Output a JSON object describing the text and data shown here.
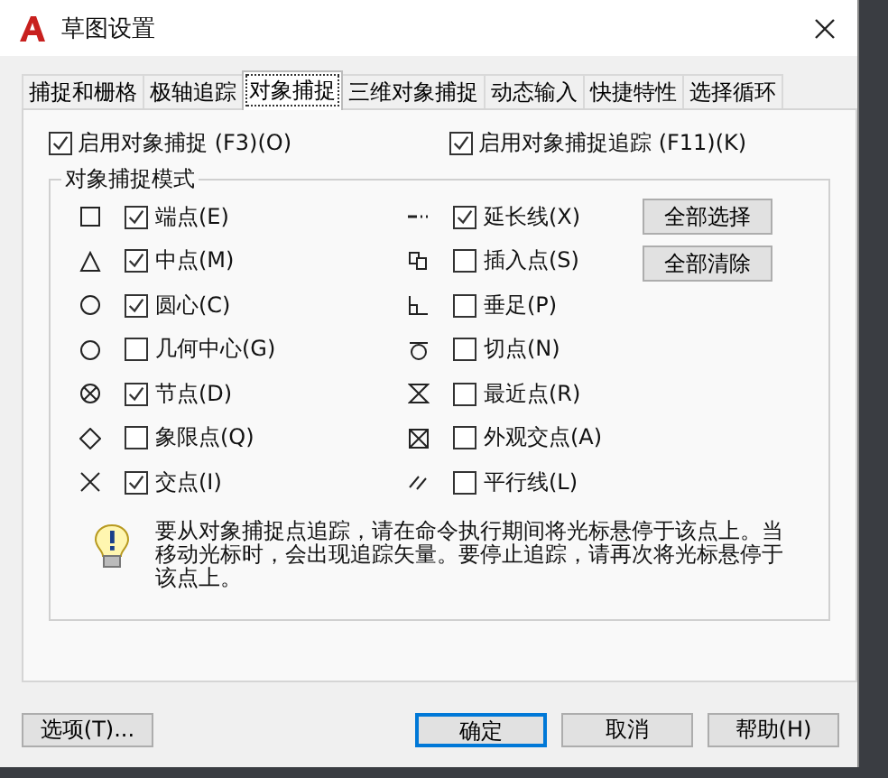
{
  "window": {
    "title": "草图设置"
  },
  "tabs": [
    {
      "label": "捕捉和栅格",
      "selected": false
    },
    {
      "label": "极轴追踪",
      "selected": false
    },
    {
      "label": "对象捕捉",
      "selected": true
    },
    {
      "label": "三维对象捕捉",
      "selected": false
    },
    {
      "label": "动态输入",
      "selected": false
    },
    {
      "label": "快捷特性",
      "selected": false
    },
    {
      "label": "选择循环",
      "selected": false
    }
  ],
  "enable_options": [
    {
      "label": "启用对象捕捉 (F3)(O)",
      "checked": true
    },
    {
      "label": "启用对象捕捉追踪 (F11)(K)",
      "checked": true
    }
  ],
  "snap_modes": {
    "title": "对象捕捉模式",
    "left": [
      {
        "label": "端点(E)",
        "checked": true
      },
      {
        "label": "中点(M)",
        "checked": true
      },
      {
        "label": "圆心(C)",
        "checked": true
      },
      {
        "label": "几何中心(G)",
        "checked": false
      },
      {
        "label": "节点(D)",
        "checked": true
      },
      {
        "label": "象限点(Q)",
        "checked": false
      },
      {
        "label": "交点(I)",
        "checked": true
      }
    ],
    "right": [
      {
        "label": "延长线(X)",
        "checked": true
      },
      {
        "label": "插入点(S)",
        "checked": false
      },
      {
        "label": "垂足(P)",
        "checked": false
      },
      {
        "label": "切点(N)",
        "checked": false
      },
      {
        "label": "最近点(R)",
        "checked": false
      },
      {
        "label": "外观交点(A)",
        "checked": false
      },
      {
        "label": "平行线(L)",
        "checked": false
      }
    ],
    "buttons": [
      "全部选择",
      "全部清除"
    ]
  },
  "info": "要从对象捕捉点追踪，请在命令执行期间将光标悬停于该点上。当移动光标时，会出现追踪矢量。要停止追踪，请再次将光标悬停于该点上。",
  "footer": {
    "options_button": "选项(T)...",
    "buttons": [
      {
        "label": "确定",
        "selected": true
      },
      {
        "label": "取消",
        "selected": false
      },
      {
        "label": "帮助(H)",
        "selected": false
      }
    ]
  }
}
